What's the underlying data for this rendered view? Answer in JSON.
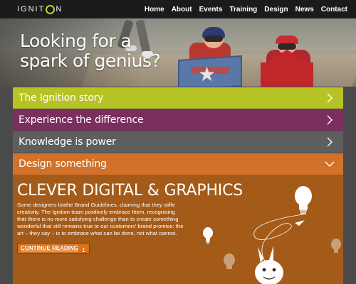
{
  "brand": {
    "logo_before": "IGNIT",
    "logo_after": "N"
  },
  "nav": {
    "items": [
      "Home",
      "About",
      "Events",
      "Training",
      "Design",
      "News",
      "Contact"
    ]
  },
  "hero": {
    "headline": "Looking for a\nspark of genius?"
  },
  "accordion": [
    {
      "label": "The Ignition story",
      "color": "#b7c224",
      "state": "collapsed"
    },
    {
      "label": "Experience the difference",
      "color": "#7a2f5f",
      "state": "collapsed"
    },
    {
      "label": "Knowledge is power",
      "color": "#5e5e5e",
      "state": "collapsed"
    },
    {
      "label": "Design something",
      "color": "#d2722a",
      "state": "expanded"
    }
  ],
  "panel": {
    "heading": "CLEVER DIGITAL & GRAPHICS",
    "body": "Some designers loathe Brand Guidelines, claiming that they stifle creativity. The Ignition team positively embrace them, recognising that there is no more satisfying challenge than to create something wonderful that still remains true to our customers' brand promise: the art – they say – is to embrace what can be done, not what cannot.",
    "cta_label": "CONTINUE READING",
    "cta_icon": "chevron-right-icon",
    "background": "#a45a18"
  },
  "colors": {
    "topbar": "#1b1b1b",
    "accent_logo": "#c6d12a"
  }
}
